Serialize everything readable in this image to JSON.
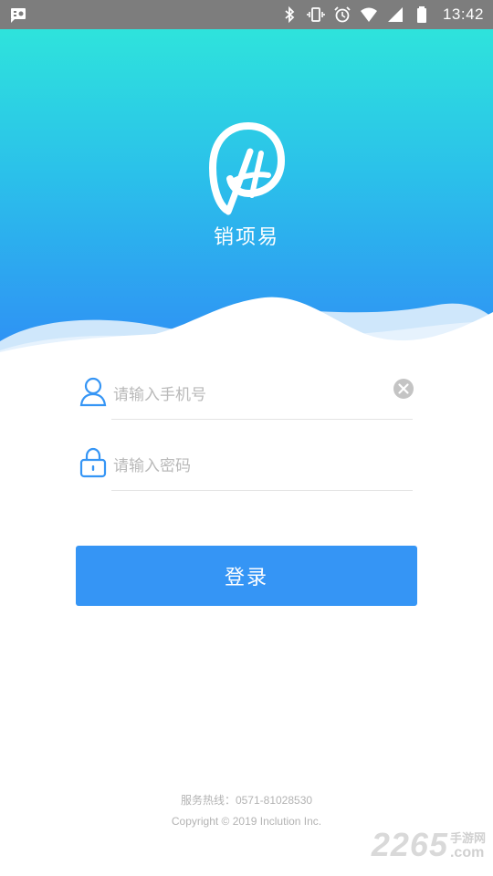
{
  "status_bar": {
    "time": "13:42",
    "icons": [
      "notification-icon",
      "bluetooth-icon",
      "vibrate-icon",
      "alarm-icon",
      "wifi-icon",
      "signal-icon",
      "battery-icon"
    ]
  },
  "app": {
    "name": "销项易",
    "gradient": [
      "#2ee3dc",
      "#2f8ff5"
    ]
  },
  "form": {
    "phone_placeholder": "请输入手机号",
    "phone_value": "",
    "password_placeholder": "请输入密码",
    "password_value": "",
    "login_label": "登录",
    "accent": "#3595f5"
  },
  "footer": {
    "hotline": "服务热线：0571-81028530",
    "copyright": "Copyright © 2019 Inclution Inc."
  },
  "watermark": {
    "number": "2265",
    "cn": "手游网",
    "com": ".com"
  }
}
